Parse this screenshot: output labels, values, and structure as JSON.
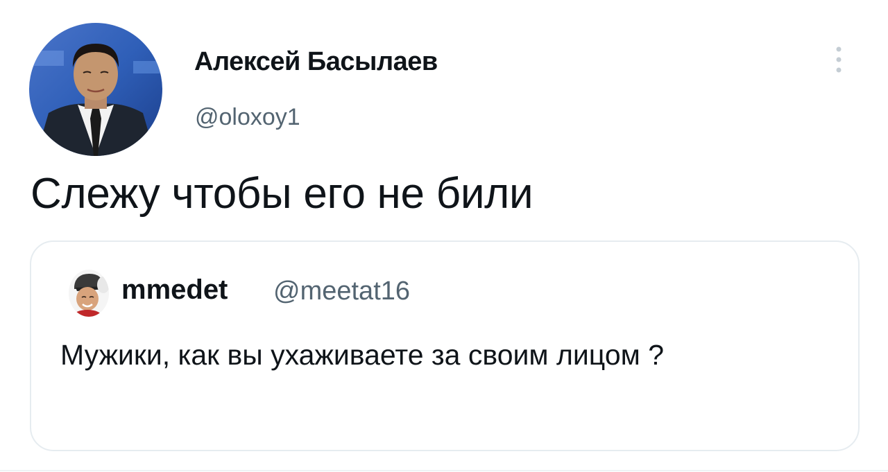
{
  "author": {
    "display_name": "Алексей Басылаев",
    "handle": "@oloxoy1"
  },
  "tweet": {
    "text": "Слежу чтобы его не били"
  },
  "quoted_tweet": {
    "display_name": "mmedet",
    "handle": "@meetat16",
    "text": "Мужики, как вы ухаживаете за своим лицом ?"
  },
  "icons": {
    "more": "more-vertical-icon"
  },
  "colors": {
    "text_primary": "#0f1419",
    "text_secondary": "#536471",
    "border": "#e6ecf0"
  }
}
